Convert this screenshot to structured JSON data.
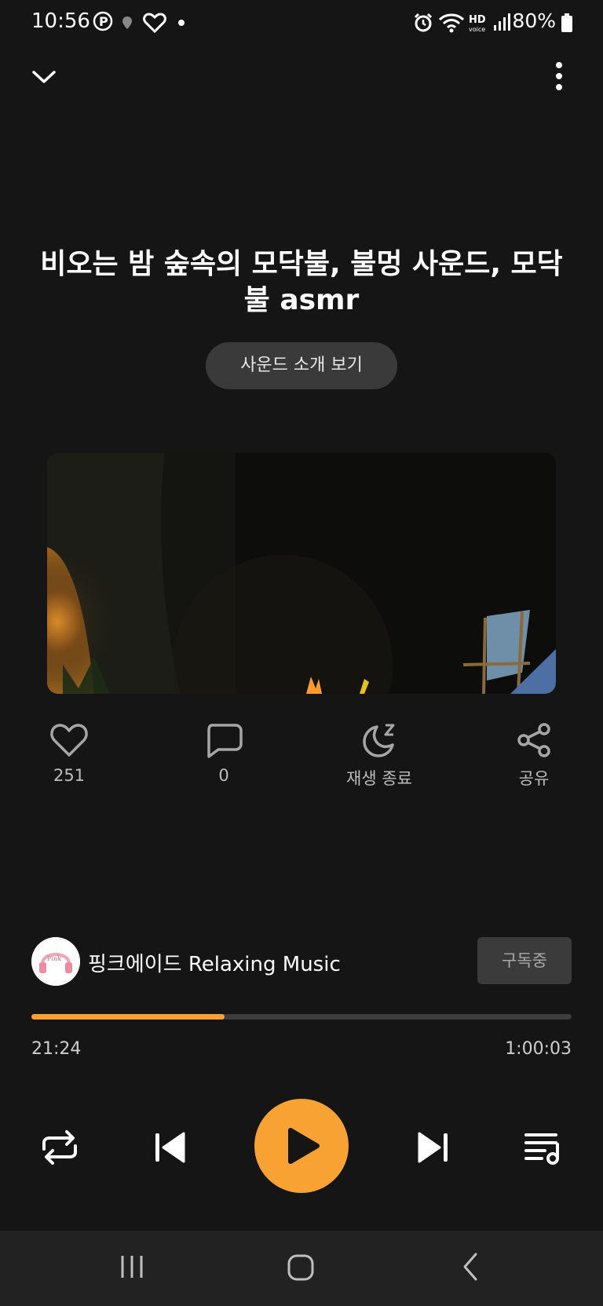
{
  "status_bar": {
    "time": "10:56",
    "battery": "80%",
    "icons": [
      "p-icon",
      "location-icon",
      "heart-badge-icon",
      "dot-icon",
      "alarm-icon",
      "wifi-icon",
      "hd-voice-icon",
      "signal-icon",
      "battery-icon"
    ]
  },
  "header": {
    "collapse_icon": "chevron-down-icon",
    "more_icon": "more-vertical-icon"
  },
  "track": {
    "title": "비오는 밤 숲속의 모닥불, 불멍 사운드, 모닥불 asmr",
    "intro_button": "사운드 소개 보기"
  },
  "actions": {
    "like_count": "251",
    "comment_count": "0",
    "sleep_label": "재생 종료",
    "share_label": "공유"
  },
  "channel": {
    "name": "핑크에이드 Relaxing Music",
    "subscribe_label": "구독중"
  },
  "progress": {
    "elapsed": "21:24",
    "total": "1:00:03",
    "fraction": 0.357
  },
  "colors": {
    "accent": "#f7a233",
    "background": "#151515"
  }
}
